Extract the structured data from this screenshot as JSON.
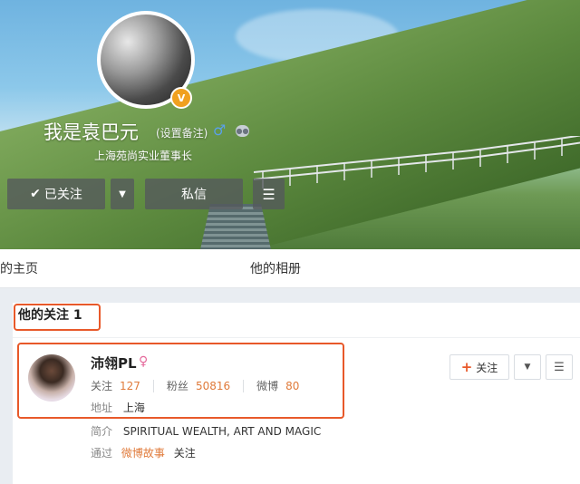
{
  "profile": {
    "name": "我是袁巴元",
    "remark_link": "(设置备注)",
    "gender_icon": "male-icon",
    "verified_icon": "verified-badge-icon",
    "subtitle": "上海苑尚实业董事长"
  },
  "actions": {
    "followed_label": "已关注",
    "message_label": "私信"
  },
  "tabs": {
    "home": "的主页",
    "album": "他的相册"
  },
  "following_section": {
    "title": "他的关注 1"
  },
  "followed_user": {
    "name": "沛翎PL",
    "gender_icon": "female-icon",
    "following_label": "关注",
    "following_count": "127",
    "fans_label": "粉丝",
    "fans_count": "50816",
    "weibo_label": "微博",
    "weibo_count": "80",
    "address_label": "地址",
    "address_value": "上海",
    "intro_label": "简介",
    "intro_value": "SPIRITUAL WEALTH, ART AND MAGIC",
    "via_prefix": "通过",
    "via_link": "微博故事",
    "via_suffix": "关注",
    "follow_button_label": "关注"
  },
  "colors": {
    "accent_orange": "#e07b3b",
    "highlight_red": "#e8592a"
  }
}
